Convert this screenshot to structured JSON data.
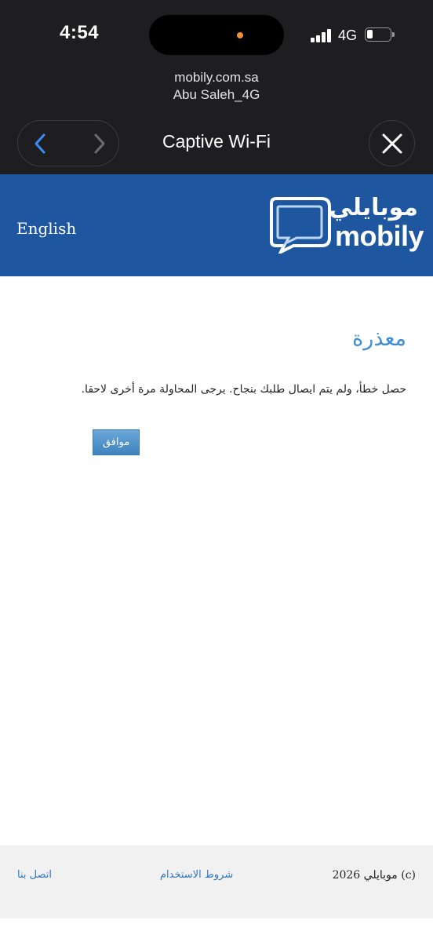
{
  "status_bar": {
    "time": "4:54",
    "network": "4G",
    "signal_icon": "cellular-signal-icon",
    "battery_icon": "battery-low-icon",
    "privacy_indicator_color": "#f0913a"
  },
  "captive_bar": {
    "host": "mobily.com.sa",
    "network_name": "Abu Saleh_4G",
    "title": "Captive Wi-Fi",
    "back_icon": "chevron-left-icon",
    "forward_icon": "chevron-right-icon",
    "close_icon": "close-icon",
    "accent": "#3a8ef5"
  },
  "header": {
    "language_link": "English",
    "logo_arabic": "موبايلي",
    "logo_english": "mobily",
    "band_color": "#1e57a0"
  },
  "error": {
    "title": "معذرة",
    "message": "حصل خطأ، ولم يتم ايصال طلبك بنجاح. يرجى المحاولة مرة أخرى لاحقا.",
    "ok_button": "موافق"
  },
  "footer": {
    "copyright": "(c) موبايلي  2026",
    "terms_link": "شروط الاستخدام",
    "contact_link": "اتصل بنا"
  }
}
